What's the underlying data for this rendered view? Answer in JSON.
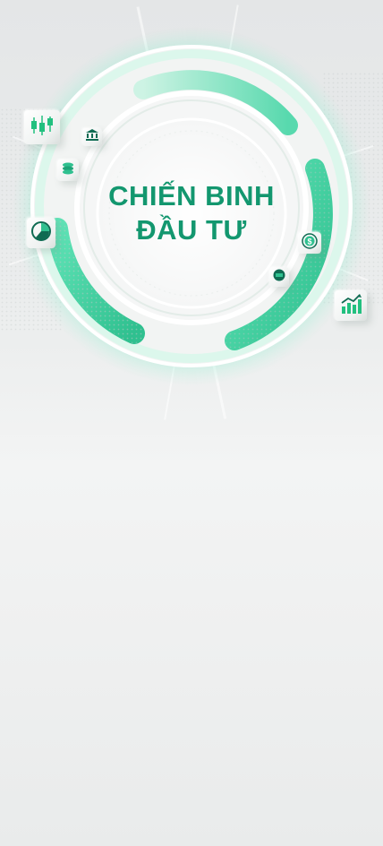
{
  "hero": {
    "title_line1": "CHIẾN BINH",
    "title_line2": "ĐẦU TƯ"
  },
  "icons": {
    "candlestick": "candlestick-chart-icon",
    "bank": "bank-icon",
    "coins": "coins-stack-icon",
    "pie": "pie-chart-icon",
    "dollar": "dollar-exchange-icon",
    "money": "money-icon",
    "growth": "growth-chart-icon"
  },
  "colors": {
    "brand": "#13976f",
    "accent": "#41d4a5",
    "background": "#eceeee"
  }
}
